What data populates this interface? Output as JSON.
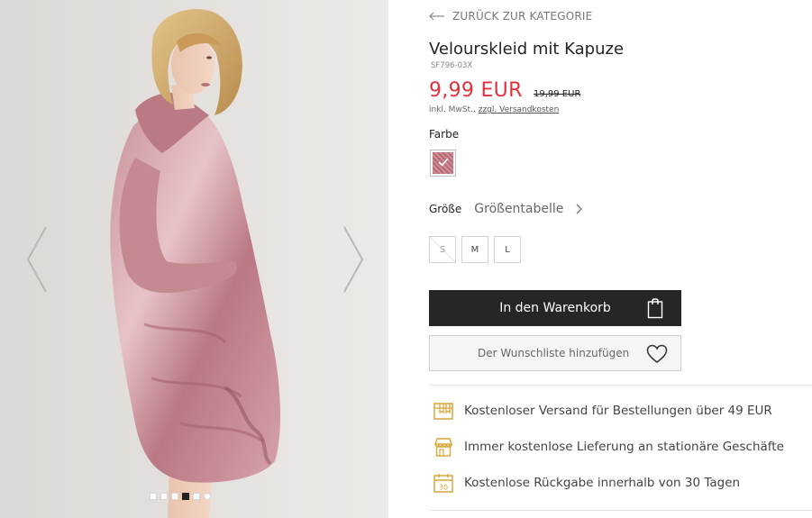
{
  "gallery": {
    "prev_icon": "chevron-left-icon",
    "next_icon": "chevron-right-icon",
    "dots_count": 6,
    "active_dot": 4
  },
  "nav": {
    "back_label": "ZURÜCK ZUR KATEGORIE",
    "back_icon": "arrow-left-icon"
  },
  "product": {
    "title": "Velourskleid mit Kapuze",
    "sku": "SF796-03X",
    "price": "9,99 EUR",
    "old_price": "19,99 EUR",
    "vat_text": "inkl. MwSt.,",
    "shipping_link": "zzgl. Versandkosten",
    "color_label": "Farbe",
    "color_swatch": "#c07a84",
    "size_label": "Größe",
    "size_table_label": "Größentabelle",
    "sizes": [
      {
        "label": "S",
        "available": false
      },
      {
        "label": "M",
        "available": true
      },
      {
        "label": "L",
        "available": true
      }
    ]
  },
  "actions": {
    "cart_label": "In den Warenkorb",
    "cart_icon": "shopping-bag-icon",
    "wishlist_label": "Der Wunschliste hinzufügen",
    "wishlist_icon": "heart-icon"
  },
  "benefits": [
    {
      "icon": "delivery-box-icon",
      "text": "Kostenloser Versand für Bestellungen über 49 EUR"
    },
    {
      "icon": "store-icon",
      "text": "Immer kostenlose Lieferung an stationäre Geschäfte"
    },
    {
      "icon": "calendar-30-icon",
      "text": "Kostenlose Rückgabe innerhalb von 30 Tagen"
    }
  ],
  "colors": {
    "accent_gold": "#d9a63a",
    "price_red": "#e0323a",
    "button_dark": "#262626"
  }
}
